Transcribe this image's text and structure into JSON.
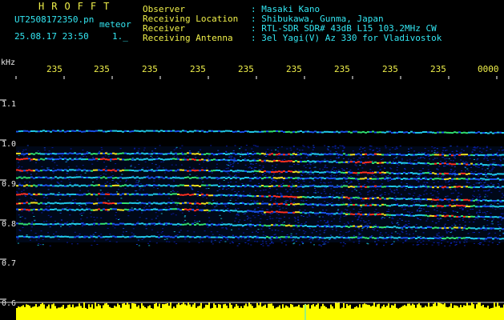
{
  "header": {
    "title": "HROFFT",
    "filename": "UT2508172350.pn",
    "meteor_label": "meteor",
    "datetime": "25.08.17 23:50",
    "datetime_extra": "1._",
    "rows": [
      {
        "label": "Observer",
        "value": ": Masaki Kano"
      },
      {
        "label": "Receiving Location",
        "value": ": Shibukawa, Gunma, Japan"
      },
      {
        "label": "Receiver",
        "value": ": RTL-SDR SDR# 43dB L15 103.2MHz CW"
      },
      {
        "label": "Receiving Antenna",
        "value": ": 3el Yagi(V) Az 330 for Vladivostok"
      }
    ]
  },
  "axes": {
    "y_unit": "kHz",
    "y_ticks": [
      "1.1",
      "1.0",
      "0.9",
      "0.8",
      "0.7",
      "0.6"
    ],
    "x_ticks": [
      "235",
      "235",
      "235",
      "235",
      "235",
      "235",
      "235",
      "235",
      "235",
      "0000"
    ]
  },
  "colors": {
    "cyan": "#33e6f2",
    "yellow": "#f0f04a",
    "background": "#000000",
    "noise_bar": "#ffff00"
  }
}
